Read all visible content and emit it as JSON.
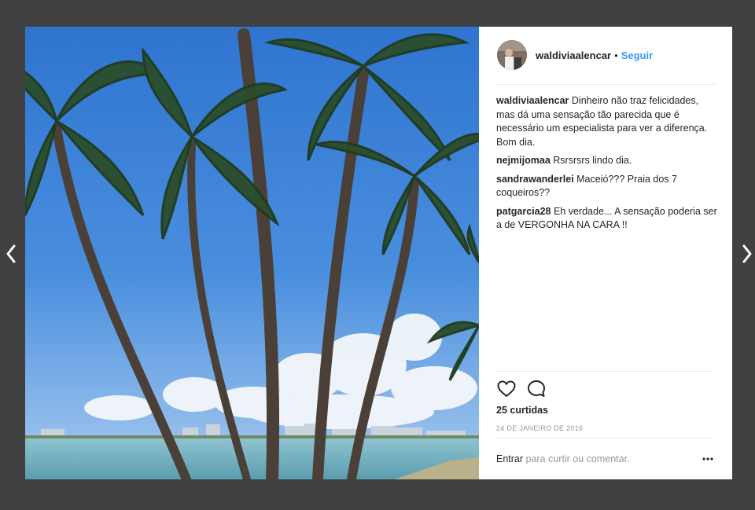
{
  "post": {
    "username": "waldiviaalencar",
    "separator": "•",
    "follow_label": "Seguir"
  },
  "comments": [
    {
      "user": "waldiviaalencar",
      "text": "Dinheiro não traz felicidades, mas dá uma sensação tão parecida que é necessário um especialista para ver a diferença. Bom dia."
    },
    {
      "user": "nejmijomaa",
      "text": "Rsrsrsrs lindo dia."
    },
    {
      "user": "sandrawanderlei",
      "text": "Maceió??? Praia dos 7 coqueiros??"
    },
    {
      "user": "patgarcia28",
      "text": "Eh verdade... A sensação poderia ser a de VERGONHA NA CARA !!"
    }
  ],
  "likes_label": "25 curtidas",
  "date_label": "24 DE JANEIRO DE 2016",
  "footer": {
    "login_label": "Entrar",
    "rest_label": "para curtir ou comentar."
  },
  "icons": {
    "prev": "chevron-left-icon",
    "next": "chevron-right-icon",
    "like": "heart-icon",
    "comment": "comment-bubble-icon",
    "more": "more-dots-icon"
  },
  "colors": {
    "backdrop": "#414141",
    "link": "#3897f0",
    "text": "#262626",
    "muted": "#999999",
    "sky": "#3a7fd6"
  }
}
